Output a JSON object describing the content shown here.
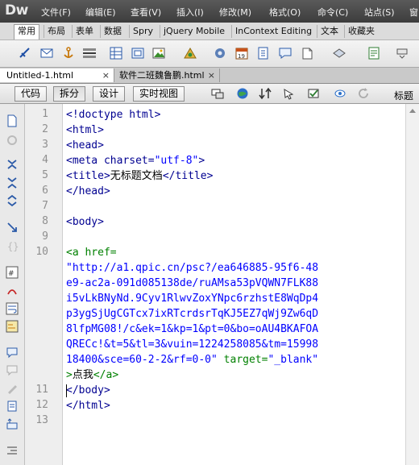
{
  "app": {
    "logo": "Dw"
  },
  "menu": [
    "文件(F)",
    "编辑(E)",
    "查看(V)",
    "插入(I)",
    "修改(M)",
    "格式(O)",
    "命令(C)",
    "站点(S)",
    "窗口"
  ],
  "insert_tabs": [
    "常用",
    "布局",
    "表单",
    "数据",
    "Spry",
    "jQuery Mobile",
    "InContext Editing",
    "文本",
    "收藏夹"
  ],
  "doc_tabs": [
    {
      "label": "Untitled-1.html",
      "close": "×"
    },
    {
      "label": "软件二班魏鲁鹏.html",
      "close": "×"
    }
  ],
  "view_buttons": [
    "代码",
    "拆分",
    "设计",
    "实时视图"
  ],
  "view_title_label": "标题",
  "line_numbers": [
    "1",
    "2",
    "3",
    "4",
    "5",
    "6",
    "7",
    "8",
    "9",
    "10",
    "11",
    "12",
    "13"
  ],
  "code_lines": {
    "l1": "<!doctype html>",
    "l2": "<html>",
    "l3": "<head>",
    "l4_a": "<meta charset=",
    "l4_b": "\"utf-8\"",
    "l4_c": ">",
    "l5_a": "<title>",
    "l5_b": "无标题文档",
    "l5_c": "</title>",
    "l6": "</head>",
    "l8": "<body>",
    "l10": "<a href=",
    "w1": "\"http://a1.qpic.cn/psc?/ea646885-95f6-48",
    "w2": "e9-ac2a-091d085138de/ruAMsa53pVQWN7FLK88",
    "w3": "i5vLkBNyNd.9Cyv1RlwvZoxYNpc6rzhstE8WqDp4",
    "w4": "p3ygSjUgCGTcx7ixRTcrdsrTqKJ5EZ7qWj9Zw6qD",
    "w5": "8lfpMG08!/c&ek=1&kp=1&pt=0&bo=oAU4BKAFOA",
    "w6": "QRECc!&t=5&tl=3&vuin=1224258085&tm=15998",
    "w7_a": "18400&sce=60-2-2&rf=0-0\"",
    "w7_b": " target=",
    "w7_c": "\"_blank\"",
    "w8_a": ">",
    "w8_b": "点我",
    "w8_c": "</a>",
    "l11": "</body>",
    "l12": "</html>"
  }
}
